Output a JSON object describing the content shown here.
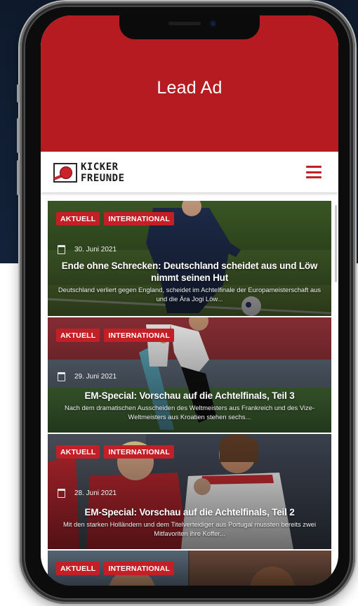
{
  "lead_ad": {
    "text": "Lead Ad"
  },
  "header": {
    "logo_line1": "KICKER",
    "logo_line2": "FREUNDE",
    "menu_icon": "hamburger-icon"
  },
  "articles": [
    {
      "tags": [
        "AKTUELL",
        "INTERNATIONAL"
      ],
      "date": "30. Juni 2021",
      "title": "Ende ohne Schrecken: Deutschland scheidet aus und Löw nimmt seinen Hut",
      "excerpt": "Deutschland verliert gegen England, scheidet im Achtelfinale der Europameisterschaft aus und die Ära Jogi Löw..."
    },
    {
      "tags": [
        "AKTUELL",
        "INTERNATIONAL"
      ],
      "date": "29. Juni 2021",
      "title": "EM-Special: Vorschau auf die Achtelfinals, Teil 3",
      "excerpt": "Nach dem dramatischen Ausscheiden des Weltmeisters aus Frankreich und des Vize-Weltmeisters aus Kroatien stehen sechs..."
    },
    {
      "tags": [
        "AKTUELL",
        "INTERNATIONAL"
      ],
      "date": "28. Juni 2021",
      "title": "EM-Special: Vorschau auf die Achtelfinals, Teil 2",
      "excerpt": "Mit den starken Holländern und dem Titelverteidiger aus Portugal mussten bereits zwei Mitfavoriten ihre Koffer..."
    },
    {
      "tags": [
        "AKTUELL",
        "INTERNATIONAL"
      ]
    }
  ],
  "colors": {
    "brand_red": "#c41f26",
    "lead_ad_red": "#b61b21"
  }
}
